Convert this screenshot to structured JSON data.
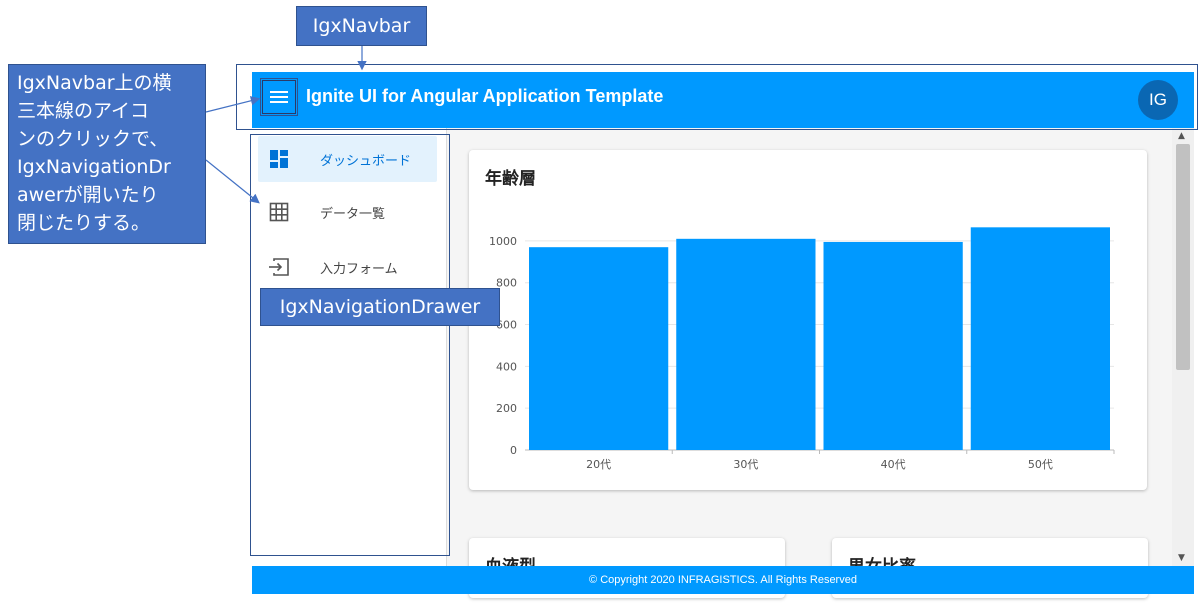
{
  "navbar": {
    "title": "Ignite UI for Angular Application Template",
    "avatar_text": "IG",
    "menu_icon": "menu-icon"
  },
  "drawer": {
    "items": [
      {
        "label": "ダッシュボード",
        "icon": "dashboard-icon",
        "active": true
      },
      {
        "label": "データ一覧",
        "icon": "grid-icon",
        "active": false
      },
      {
        "label": "入力フォーム",
        "icon": "input-icon",
        "active": false
      }
    ]
  },
  "cards": {
    "age": {
      "title": "年齢層"
    },
    "blood": {
      "title": "血液型"
    },
    "gender": {
      "title": "男女比率"
    }
  },
  "chart_data": {
    "type": "bar",
    "categories": [
      "20代",
      "30代",
      "40代",
      "50代"
    ],
    "values": [
      970,
      1010,
      995,
      1065
    ],
    "yticks": [
      0,
      200,
      400,
      600,
      800,
      1000
    ],
    "ylim": [
      0,
      1100
    ],
    "color": "#0099ff",
    "grid": true
  },
  "footer": {
    "text": "© Copyright 2020 INFRAGISTICS. All Rights Reserved"
  },
  "annotations": {
    "navbar_label": "IgxNavbar",
    "drawer_label": "IgxNavigationDrawer",
    "description_lines": [
      "IgxNavbar上の横",
      "三本線のアイコ",
      "ンのクリックで、",
      "IgxNavigationDr",
      "awerが開いたり",
      "閉じたりする。"
    ]
  },
  "colors": {
    "primary": "#0099ff",
    "callout": "#4472c4",
    "avatar": "#0a67b3",
    "active_bg": "#e3f2fd"
  }
}
